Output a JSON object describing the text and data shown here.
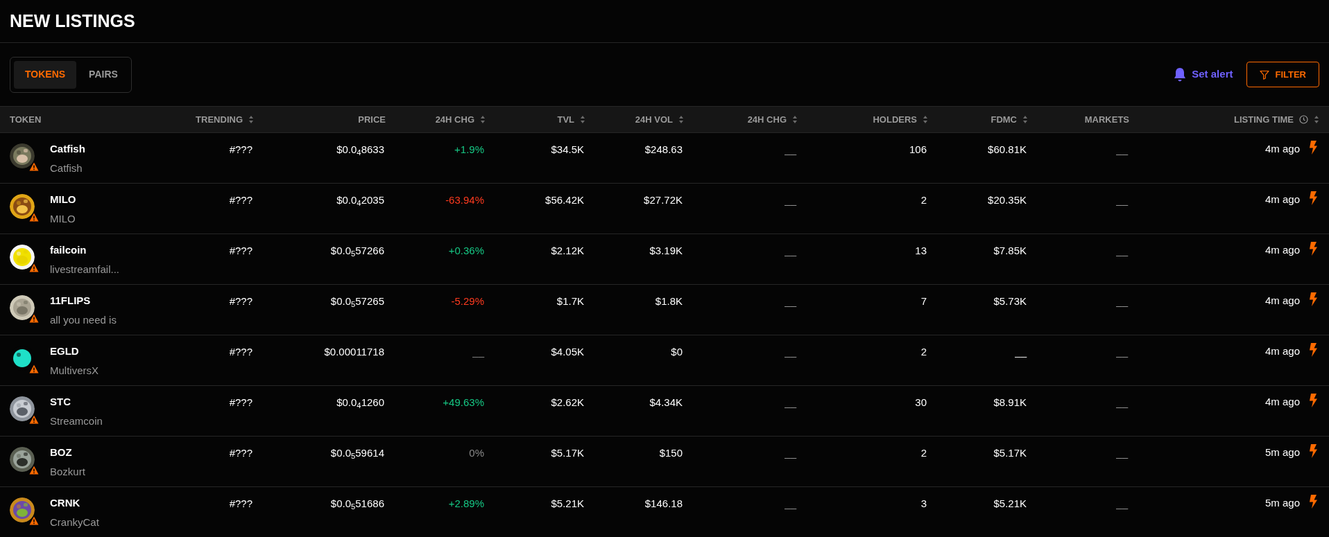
{
  "page": {
    "title": "NEW LISTINGS"
  },
  "tabs": [
    {
      "label": "TOKENS",
      "selected": true
    },
    {
      "label": "PAIRS",
      "selected": false
    }
  ],
  "alert_button": {
    "label": "Set alert"
  },
  "filter_button": {
    "label": "FILTER"
  },
  "table": {
    "columns": [
      {
        "label": "TOKEN",
        "sortable": false,
        "kind": "plain"
      },
      {
        "label": "TRENDING",
        "sortable": true,
        "kind": "plain"
      },
      {
        "label": "PRICE",
        "sortable": false,
        "kind": "plain"
      },
      {
        "label": "24H CHG",
        "sortable": true,
        "kind": "plain"
      },
      {
        "label": "TVL",
        "sortable": true,
        "kind": "plain"
      },
      {
        "label": "24H VOL",
        "sortable": true,
        "kind": "plain"
      },
      {
        "label": "24H CHG",
        "sortable": true,
        "kind": "plain"
      },
      {
        "label": "HOLDERS",
        "sortable": true,
        "kind": "plain"
      },
      {
        "label": "FDMC",
        "sortable": true,
        "kind": "plain"
      },
      {
        "label": "MARKETS",
        "sortable": false,
        "kind": "plain"
      },
      {
        "label": "LISTING TIME",
        "sortable": true,
        "kind": "timed"
      }
    ],
    "rows": [
      {
        "symbol": "Catfish",
        "name": "Catfish",
        "warning": true,
        "trending": "#???",
        "price": "$0.0$_{4}$8633",
        "change": "+1.9%",
        "color": "#16c784",
        "tvl": "$34.5K",
        "volume": "$248.63",
        "change_2": "__",
        "holders": "106",
        "fdmc": "$60.81K",
        "markets": "__",
        "listing_time": "4m ago"
      },
      {
        "symbol": "MILO",
        "name": "MILO",
        "warning": true,
        "trending": "#???",
        "price": "$0.0$_{4}$2035",
        "change": "-63.94%",
        "color": "#ff3b1f",
        "tvl": "$56.42K",
        "volume": "$27.72K",
        "change_2": "__",
        "holders": "2",
        "fdmc": "$20.35K",
        "markets": "__",
        "listing_time": "4m ago"
      },
      {
        "symbol": "failcoin",
        "name": "livestreamfail...",
        "warning": true,
        "trending": "#???",
        "price": "$0.0$_{5}$57266",
        "change": "+0.36%",
        "color": "#16c784",
        "tvl": "$2.12K",
        "volume": "$3.19K",
        "change_2": "__",
        "holders": "13",
        "fdmc": "$7.85K",
        "markets": "__",
        "listing_time": "4m ago"
      },
      {
        "symbol": "11FLIPS",
        "name": "all you need is",
        "warning": true,
        "trending": "#???",
        "price": "$0.0$_{5}$57265",
        "change": "-5.29%",
        "color": "#ff3b1f",
        "tvl": "$1.7K",
        "volume": "$1.8K",
        "change_2": "__",
        "holders": "7",
        "fdmc": "$5.73K",
        "markets": "__",
        "listing_time": "4m ago"
      },
      {
        "symbol": "EGLD",
        "name": "MultiversX",
        "warning": true,
        "trending": "#???",
        "price": "$0.00011718",
        "change": "__",
        "color": "#8a8a8a",
        "tvl": "$4.05K",
        "volume": "$0",
        "change_2": "__",
        "holders": "2",
        "fdmc": "__",
        "markets": "__",
        "listing_time": "4m ago"
      },
      {
        "symbol": "STC",
        "name": "Streamcoin",
        "warning": true,
        "trending": "#???",
        "price": "$0.0$_{4}$1260",
        "change": "+49.63%",
        "color": "#16c784",
        "tvl": "$2.62K",
        "volume": "$4.34K",
        "change_2": "__",
        "holders": "30",
        "fdmc": "$8.91K",
        "markets": "__",
        "listing_time": "4m ago"
      },
      {
        "symbol": "BOZ",
        "name": "Bozkurt",
        "warning": true,
        "trending": "#???",
        "price": "$0.0$_{5}$59614",
        "change": "0%",
        "color": "#8a8a8a",
        "tvl": "$5.17K",
        "volume": "$150",
        "change_2": "__",
        "holders": "2",
        "fdmc": "$5.17K",
        "markets": "__",
        "listing_time": "5m ago"
      },
      {
        "symbol": "CRNK",
        "name": "CrankyCat",
        "warning": true,
        "trending": "#???",
        "price": "$0.0$_{5}$51686",
        "change": "+2.89%",
        "color": "#16c784",
        "tvl": "$5.21K",
        "volume": "$146.18",
        "change_2": "__",
        "holders": "3",
        "fdmc": "$5.21K",
        "markets": "__",
        "listing_time": "5m ago"
      }
    ]
  }
}
